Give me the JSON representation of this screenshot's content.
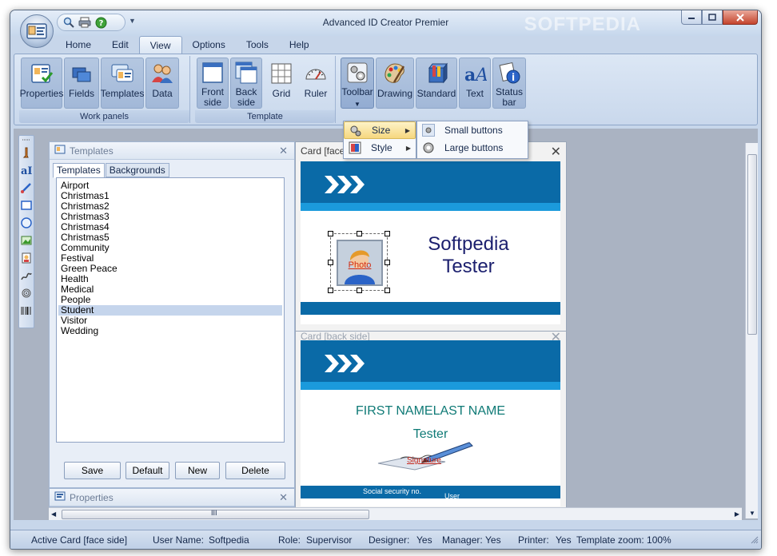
{
  "window": {
    "title": "Advanced ID Creator Premier",
    "watermark": "SOFTPEDIA"
  },
  "menu_tabs": [
    "Home",
    "Edit",
    "View",
    "Options",
    "Tools",
    "Help"
  ],
  "active_tab": "View",
  "ribbon": {
    "groups": [
      {
        "label": "Work panels",
        "buttons": [
          {
            "label": "Properties",
            "icon": "properties-icon"
          },
          {
            "label": "Fields",
            "icon": "fields-icon"
          },
          {
            "label": "Templates",
            "icon": "templates-icon"
          },
          {
            "label": "Data",
            "icon": "data-icon"
          }
        ]
      },
      {
        "label": "Template",
        "buttons": [
          {
            "label": "Front side",
            "icon": "front-side-icon"
          },
          {
            "label": "Back side",
            "icon": "back-side-icon"
          },
          {
            "label": "Grid",
            "icon": "grid-icon"
          },
          {
            "label": "Ruler",
            "icon": "ruler-icon"
          }
        ]
      },
      {
        "label": "",
        "buttons": [
          {
            "label": "Toolbar",
            "icon": "toolbar-icon"
          },
          {
            "label": "Drawing",
            "icon": "drawing-palette-icon"
          },
          {
            "label": "Standard",
            "icon": "standard-icon"
          },
          {
            "label": "Text",
            "icon": "text-icon"
          },
          {
            "label": "Status bar",
            "icon": "status-bar-icon"
          }
        ]
      }
    ]
  },
  "toolbar_menu": {
    "items": [
      {
        "label": "Size",
        "icon": "size-icon"
      },
      {
        "label": "Style",
        "icon": "style-icon"
      }
    ],
    "size_submenu": [
      {
        "label": "Small buttons",
        "icon": "small-buttons-icon"
      },
      {
        "label": "Large buttons",
        "icon": "large-buttons-icon"
      }
    ]
  },
  "templates_panel": {
    "title": "Templates",
    "tabs": [
      "Templates",
      "Backgrounds"
    ],
    "items": [
      "Airport",
      "Christmas1",
      "Christmas2",
      "Christmas3",
      "Christmas4",
      "Christmas5",
      "Community",
      "Festival",
      "Green Peace",
      "Health",
      "Medical",
      "People",
      "Student",
      "Visitor",
      "Wedding"
    ],
    "selected": "Student",
    "buttons": [
      "Save",
      "Default",
      "New",
      "Delete"
    ]
  },
  "properties_panel": {
    "title": "Properties"
  },
  "front_card": {
    "title": "Card [face side]",
    "title_visible": "Card [face",
    "name_line1": "Softpedia",
    "name_line2": "Tester",
    "photo_label": "Photo"
  },
  "back_card": {
    "title": "Card [back side]",
    "name": "FIRST NAMELAST NAME",
    "role": "Tester",
    "signature_label": "Signature",
    "social_security": "Social security no.",
    "user": "User"
  },
  "scroll_glyph": "III",
  "statusbar": {
    "active_card": "Active Card [face side]",
    "user_name_label": "User Name:",
    "user_name": "Softpedia",
    "role_label": "Role:",
    "role": "Supervisor",
    "designer_label": "Designer:",
    "designer": "Yes",
    "manager_label": "Manager:",
    "manager": "Yes",
    "printer_label": "Printer:",
    "printer": "Yes",
    "zoom": "Template zoom: 100%"
  },
  "colors": {
    "card_blue": "#0a6aa7",
    "card_light_blue": "#1b9adc",
    "menu_hover": "#f6d77f",
    "list_selection": "#c5d5ec"
  }
}
